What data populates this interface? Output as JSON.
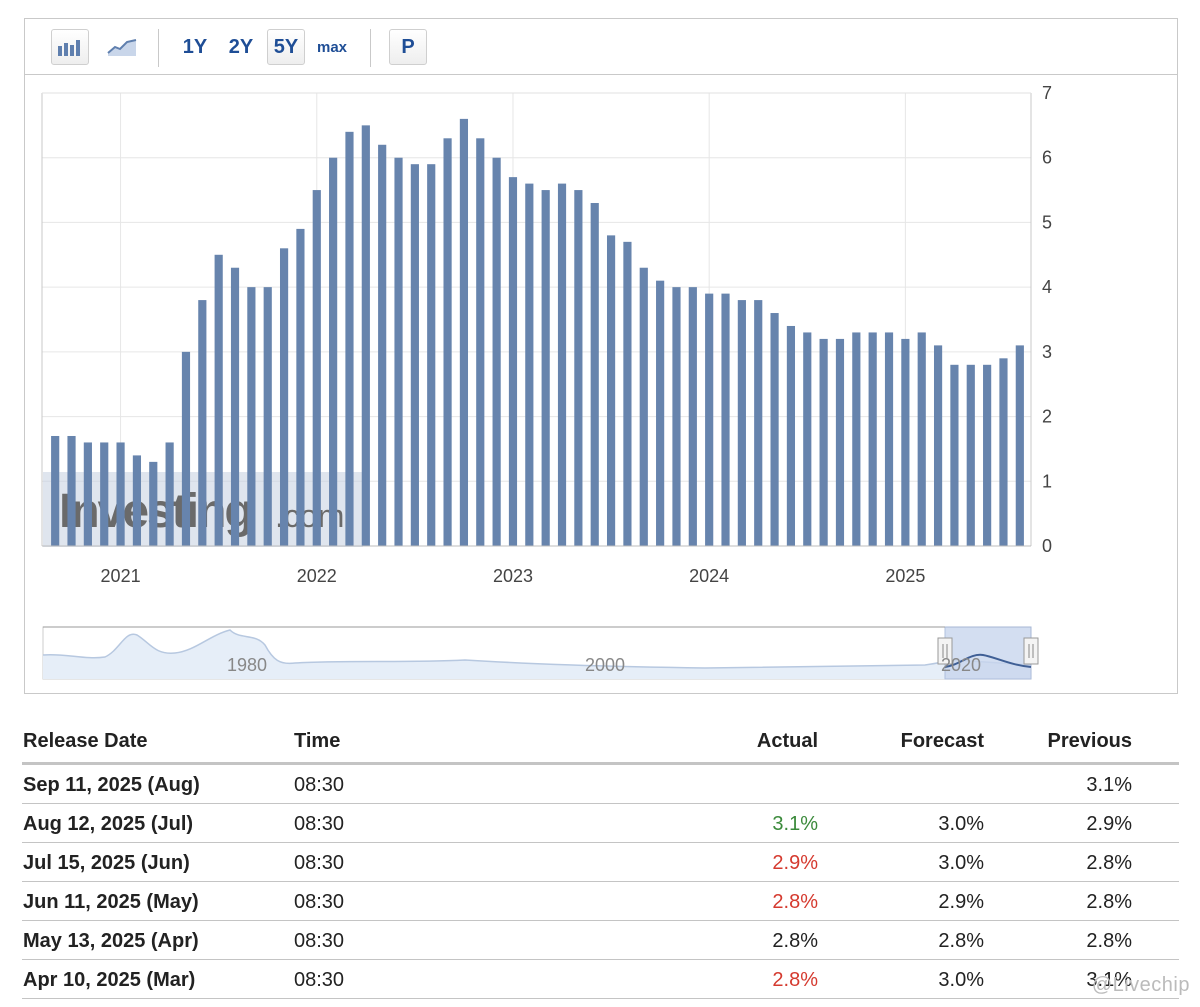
{
  "toolbar": {
    "bar_chart_button": "bar-chart",
    "line_chart_button": "line-chart",
    "ranges": [
      "1Y",
      "2Y",
      "5Y",
      "max"
    ],
    "active_range": "5Y",
    "p_button": "P"
  },
  "logo": {
    "text_main": "Investing",
    "text_suffix": ".com"
  },
  "colors": {
    "bar": "#6784ad",
    "accent": "#1f4e96",
    "positive": "#3b8a3b",
    "negative": "#d53a2f",
    "grid": "#e6e6e6"
  },
  "chart_data": {
    "type": "bar",
    "ylim": [
      0,
      7
    ],
    "yticks": [
      0,
      1,
      2,
      3,
      4,
      5,
      6,
      7
    ],
    "xtick_labels": [
      "2021",
      "2022",
      "2023",
      "2024",
      "2025"
    ],
    "x_start": "2020-09",
    "x_end": "2025-07",
    "values": [
      1.7,
      1.7,
      1.6,
      1.6,
      1.6,
      1.4,
      1.3,
      1.6,
      3.0,
      3.8,
      4.5,
      4.3,
      4.0,
      4.0,
      4.6,
      4.9,
      5.5,
      6.0,
      6.4,
      6.5,
      6.2,
      6.0,
      5.9,
      5.9,
      6.3,
      6.6,
      6.3,
      6.0,
      5.7,
      5.6,
      5.5,
      5.6,
      5.5,
      5.3,
      4.8,
      4.7,
      4.3,
      4.1,
      4.0,
      4.0,
      3.9,
      3.9,
      3.8,
      3.8,
      3.6,
      3.4,
      3.3,
      3.2,
      3.2,
      3.3,
      3.3,
      3.3,
      3.2,
      3.3,
      3.1,
      2.8,
      2.8,
      2.8,
      2.9,
      3.1
    ],
    "navigator_labels": [
      "1980",
      "2000",
      "2020"
    ]
  },
  "table": {
    "headers": {
      "date": "Release Date",
      "time": "Time",
      "actual": "Actual",
      "forecast": "Forecast",
      "previous": "Previous"
    },
    "rows": [
      {
        "date": "Sep 11, 2025 (Aug)",
        "time": "08:30",
        "actual": "",
        "actual_status": "neutral",
        "forecast": "",
        "previous": "3.1%"
      },
      {
        "date": "Aug 12, 2025 (Jul)",
        "time": "08:30",
        "actual": "3.1%",
        "actual_status": "positive",
        "forecast": "3.0%",
        "previous": "2.9%"
      },
      {
        "date": "Jul 15, 2025 (Jun)",
        "time": "08:30",
        "actual": "2.9%",
        "actual_status": "negative",
        "forecast": "3.0%",
        "previous": "2.8%"
      },
      {
        "date": "Jun 11, 2025 (May)",
        "time": "08:30",
        "actual": "2.8%",
        "actual_status": "negative",
        "forecast": "2.9%",
        "previous": "2.8%"
      },
      {
        "date": "May 13, 2025 (Apr)",
        "time": "08:30",
        "actual": "2.8%",
        "actual_status": "neutral",
        "forecast": "2.8%",
        "previous": "2.8%"
      },
      {
        "date": "Apr 10, 2025 (Mar)",
        "time": "08:30",
        "actual": "2.8%",
        "actual_status": "negative",
        "forecast": "3.0%",
        "previous": "3.1%"
      }
    ]
  },
  "watermark": "@Livechip"
}
